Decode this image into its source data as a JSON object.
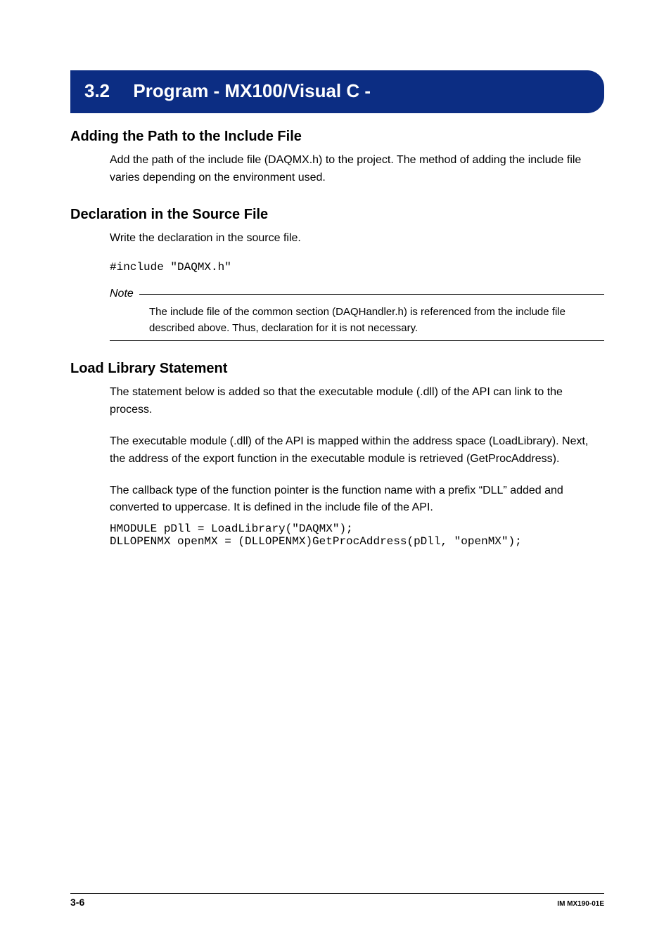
{
  "banner": {
    "number": "3.2",
    "title": "Program - MX100/Visual C -"
  },
  "sections": {
    "adding_path": {
      "heading": "Adding the Path to the Include File",
      "body": "Add the path of the include file (DAQMX.h) to the project. The method of adding the include file varies depending on the environment used."
    },
    "declaration": {
      "heading": "Declaration in the Source File",
      "body": "Write the declaration in the source file.",
      "code": "#include \"DAQMX.h\"",
      "note_label": "Note",
      "note_text": "The include file of the common section (DAQHandler.h) is referenced from the include file described above. Thus, declaration for it is not necessary."
    },
    "load_library": {
      "heading": "Load Library Statement",
      "body1": "The statement below is added so that the executable module (.dll) of the API can link to the process.",
      "body2": "The executable module (.dll) of the API is mapped within the address space (LoadLibrary). Next, the address of the export function in the executable module is retrieved (GetProcAddress).",
      "body3": "The callback type of the function pointer is the function name with a prefix “DLL” added and converted to uppercase. It is defined in the include file of the API.",
      "code": "HMODULE pDll = LoadLibrary(\"DAQMX\");\nDLLOPENMX openMX = (DLLOPENMX)GetProcAddress(pDll, \"openMX\");"
    }
  },
  "footer": {
    "page": "3-6",
    "doc_id": "IM MX190-01E"
  }
}
